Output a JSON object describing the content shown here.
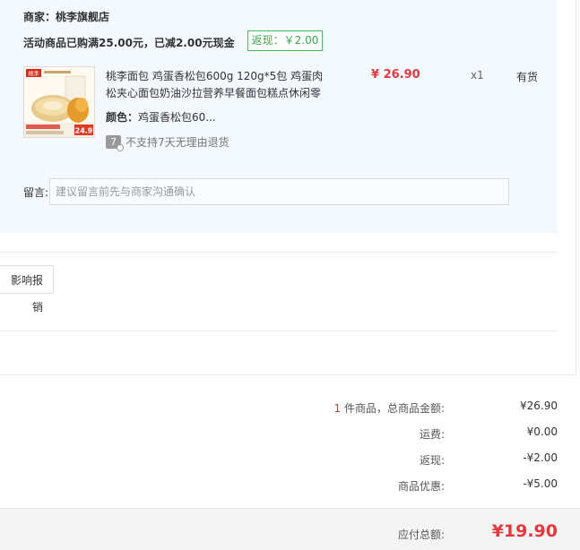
{
  "order": {
    "seller": "商家：桃李旗舰店",
    "promo_text": "活动商品已购满25.00元，已减2.00元现金",
    "rebate_tag": "返现：￥2.00",
    "item": {
      "title": "桃李面包 鸡蛋香松包600g 120g*5包 鸡蛋肉松夹心面包奶油沙拉营养早餐面包糕点休闲零",
      "color_label": "颜色：",
      "color_value": "鸡蛋香松包60...",
      "no_return_icon": "7",
      "no_return_text": "不支持7天无理由退货",
      "price": "¥ 26.90",
      "quantity": "x1",
      "stock": "有货",
      "thumb_brand": "桃李",
      "thumb_price": "24.9"
    },
    "message_label": "留言:",
    "message_placeholder": "建议留言前先与商家沟通确认"
  },
  "reimburse_button": "影响报销",
  "summary": {
    "count": "1",
    "count_suffix": " 件商品，总商品金额:",
    "total_goods": "¥26.90",
    "shipping_label": "运费:",
    "shipping": "¥0.00",
    "rebate_label": "返现:",
    "rebate": "-¥2.00",
    "discount_label": "商品优惠:",
    "discount": "-¥5.00",
    "payable_label": "应付总额:",
    "payable": "¥19.90"
  },
  "colors": {
    "accent_red": "#e4393c",
    "rebate_green": "#3aa64d",
    "order_bg": "#f3f9fe"
  }
}
